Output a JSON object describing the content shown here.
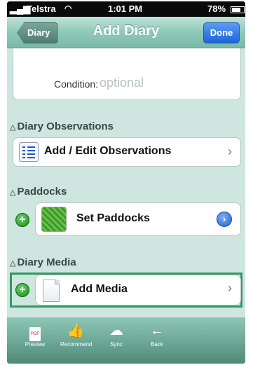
{
  "status_bar": {
    "carrier": "Telstra",
    "time": "1:01 PM",
    "battery": "78%"
  },
  "nav": {
    "back_label": "Diary",
    "title": "Add Diary",
    "done_label": "Done"
  },
  "condition": {
    "label": "Condition:",
    "placeholder": "optional"
  },
  "sections": {
    "observations": {
      "title": "Diary Observations",
      "row_label": "Add / Edit Observations"
    },
    "paddocks": {
      "title": "Paddocks",
      "row_label": "Set Paddocks"
    },
    "media": {
      "title": "Diary Media",
      "row_label": "Add Media"
    }
  },
  "toolbar": {
    "items": [
      {
        "label": "Preview",
        "icon": "pdf-icon"
      },
      {
        "label": "Recommend",
        "icon": "thumbs-up-icon"
      },
      {
        "label": "Sync",
        "icon": "sync-icon"
      },
      {
        "label": "Back",
        "icon": "back-arrow-icon"
      }
    ],
    "pdf_text": "PDF"
  },
  "colors": {
    "nav_green": "#8fc9b9",
    "content_bg": "#cfe6e0",
    "done_blue": "#1e64d8",
    "highlight_outline": "#2f9a62",
    "add_green": "#168a16"
  }
}
